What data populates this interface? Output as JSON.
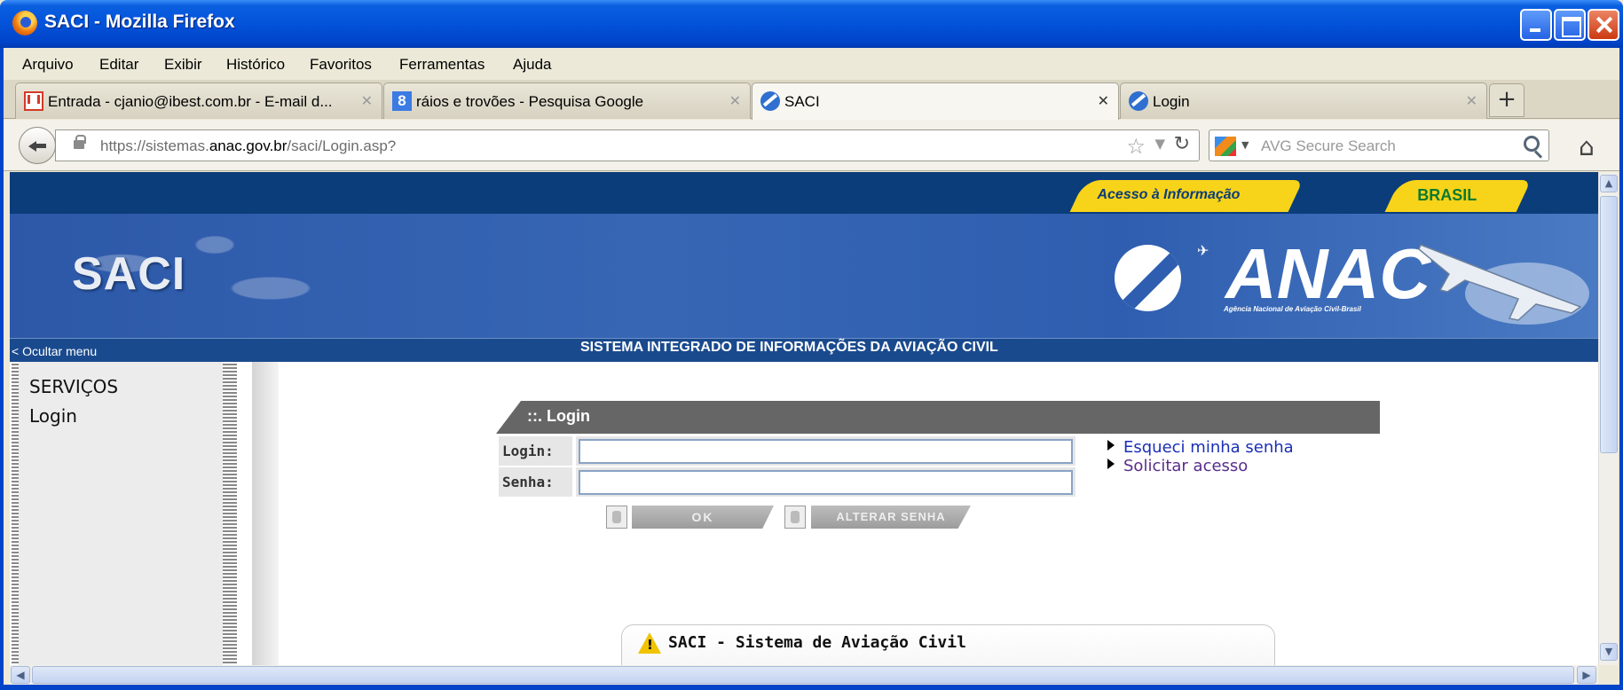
{
  "window": {
    "title": "SACI - Mozilla Firefox",
    "controls": [
      "minimize",
      "maximize",
      "close"
    ]
  },
  "menubar": {
    "items": [
      "Arquivo",
      "Editar",
      "Exibir",
      "Histórico",
      "Favoritos",
      "Ferramentas",
      "Ajuda"
    ]
  },
  "tabs": [
    {
      "label": "Entrada - cjanio@ibest.com.br - E-mail d...",
      "icon": "gmail-icon",
      "active": false
    },
    {
      "label": "ráios e trovões - Pesquisa Google",
      "icon": "google-icon",
      "active": false
    },
    {
      "label": "SACI",
      "icon": "anac-icon",
      "active": true
    },
    {
      "label": "Login",
      "icon": "anac-icon",
      "active": false
    }
  ],
  "navbar": {
    "url_prefix": "https://sistemas.",
    "url_domain": "anac.gov.br",
    "url_path": "/saci/Login.asp?",
    "search_placeholder": "AVG Secure Search"
  },
  "page": {
    "gov_links": {
      "acesso": "Acesso à Informação",
      "brasil": "BRASIL"
    },
    "banner": {
      "system_logo": "SACI",
      "agency_logo": "ANAC",
      "agency_subtitle": "Agência Nacional de Aviação Civil-Brasil"
    },
    "subbar": {
      "hide_menu": "< Ocultar menu",
      "system_name": "SISTEMA INTEGRADO DE INFORMAÇÕES DA AVIAÇÃO CIVIL"
    },
    "sidebar": {
      "items": [
        "SERVIÇOS",
        "Login"
      ]
    },
    "login": {
      "header": "::. Login",
      "login_label": "Login:",
      "login_value": "",
      "password_label": "Senha:",
      "password_value": "",
      "ok_button": "OK",
      "change_password_button": "ALTERAR SENHA",
      "links": [
        "Esqueci minha senha",
        "Solicitar acesso"
      ]
    },
    "notice": {
      "title": "SACI - Sistema de Aviação Civil"
    }
  },
  "colors": {
    "gov_bar": "#0b3d7a",
    "gov_yellow": "#f7d31a",
    "banner_blue": "#2f5eb0",
    "link": "#1a2fb8",
    "visited_link": "#5a2d8c",
    "login_header": "#666666"
  }
}
